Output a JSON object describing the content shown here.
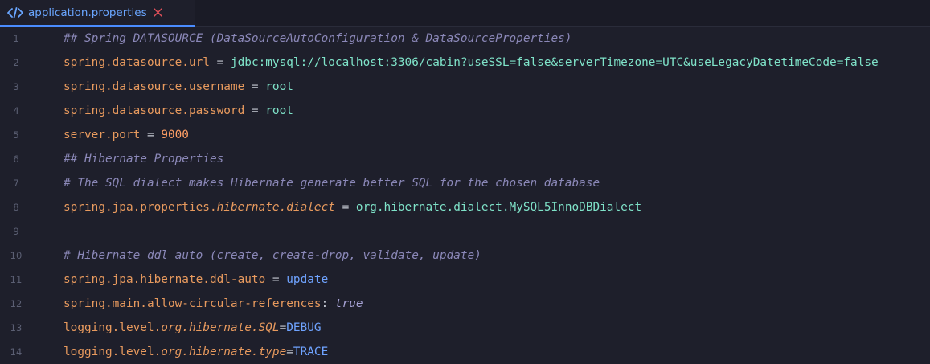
{
  "tab": {
    "title": "application.properties",
    "icon": "code-icon"
  },
  "colors": {
    "background": "#1e1f2b",
    "tab_accent": "#4a8cff",
    "key": "#e89a5e",
    "value": "#7fe3c9",
    "number": "#ff9e64",
    "keyword": "#6fa3ff",
    "comment": "#8b88b8"
  },
  "lines": [
    {
      "n": "1",
      "parts": [
        {
          "t": "## Spring DATASOURCE (DataSourceAutoConfiguration & DataSourceProperties)",
          "c": "comment"
        }
      ]
    },
    {
      "n": "2",
      "parts": [
        {
          "t": "spring.datasource.url",
          "c": "key"
        },
        {
          "t": " = ",
          "c": "op"
        },
        {
          "t": "jdbc:mysql://localhost:3306/cabin?useSSL=false&serverTimezone=UTC&useLegacyDatetimeCode=false",
          "c": "val"
        }
      ]
    },
    {
      "n": "3",
      "parts": [
        {
          "t": "spring.datasource.username",
          "c": "key"
        },
        {
          "t": " = ",
          "c": "op"
        },
        {
          "t": "root",
          "c": "val"
        }
      ]
    },
    {
      "n": "4",
      "parts": [
        {
          "t": "spring.datasource.password",
          "c": "key"
        },
        {
          "t": " = ",
          "c": "op"
        },
        {
          "t": "root",
          "c": "val"
        }
      ]
    },
    {
      "n": "5",
      "parts": [
        {
          "t": "server.port",
          "c": "key"
        },
        {
          "t": " = ",
          "c": "op"
        },
        {
          "t": "9000",
          "c": "num"
        }
      ]
    },
    {
      "n": "6",
      "parts": [
        {
          "t": "## Hibernate Properties",
          "c": "comment"
        }
      ]
    },
    {
      "n": "7",
      "parts": [
        {
          "t": "# The SQL dialect makes Hibernate generate better SQL for the chosen database",
          "c": "comment"
        }
      ]
    },
    {
      "n": "8",
      "parts": [
        {
          "t": "spring.jpa.properties.",
          "c": "key"
        },
        {
          "t": "hibernate.dialect",
          "c": "key-it"
        },
        {
          "t": " = ",
          "c": "op"
        },
        {
          "t": "org.hibernate.dialect.MySQL5InnoDBDialect",
          "c": "val"
        }
      ]
    },
    {
      "n": "9",
      "parts": []
    },
    {
      "n": "10",
      "parts": [
        {
          "t": "# Hibernate ddl auto (create, create-drop, validate, update)",
          "c": "comment"
        }
      ]
    },
    {
      "n": "11",
      "parts": [
        {
          "t": "spring.jpa.hibernate.ddl-auto",
          "c": "key"
        },
        {
          "t": " = ",
          "c": "op"
        },
        {
          "t": "update",
          "c": "kw"
        }
      ]
    },
    {
      "n": "12",
      "parts": [
        {
          "t": "spring.main.allow-circular-references",
          "c": "key"
        },
        {
          "t": ": ",
          "c": "op"
        },
        {
          "t": "true",
          "c": "bool"
        }
      ]
    },
    {
      "n": "13",
      "parts": [
        {
          "t": "logging.level.",
          "c": "key"
        },
        {
          "t": "org.hibernate.SQL",
          "c": "key-it"
        },
        {
          "t": "=",
          "c": "op"
        },
        {
          "t": "DEBUG",
          "c": "kw"
        }
      ]
    },
    {
      "n": "14",
      "parts": [
        {
          "t": "logging.level.",
          "c": "key"
        },
        {
          "t": "org.hibernate.type",
          "c": "key-it"
        },
        {
          "t": "=",
          "c": "op"
        },
        {
          "t": "TRACE",
          "c": "kw"
        }
      ]
    }
  ]
}
